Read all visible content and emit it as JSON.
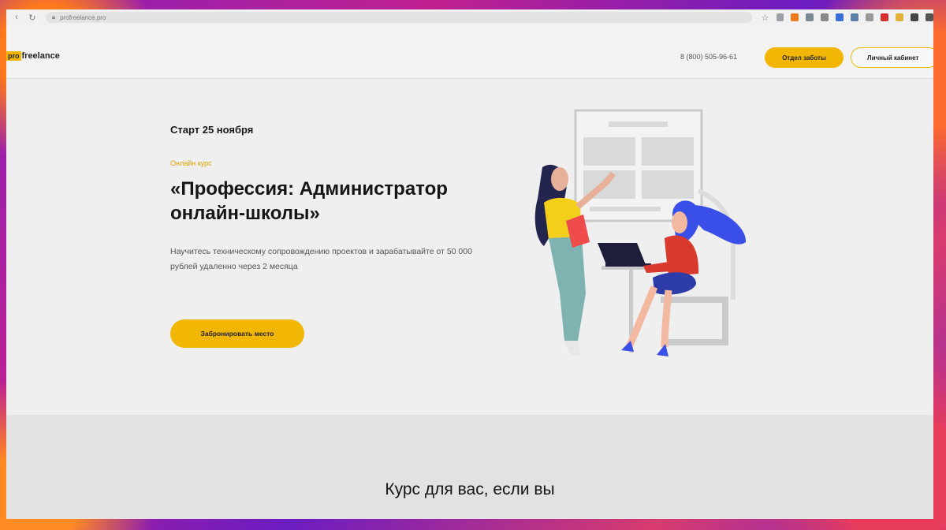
{
  "browser": {
    "url": "profreelance.pro"
  },
  "header": {
    "logo_prefix": "pro",
    "logo_text": "freelance",
    "phone": "8 (800) 505-96-61",
    "care_button": "Отдел заботы",
    "cabinet_button": "Личный кабинет"
  },
  "hero": {
    "start": "Старт 25 ноября",
    "tag": "Онлайн курс",
    "title": "«Профессия: Администратор онлайн-школы»",
    "description": "Научитесь техническому сопровождению проектов и зарабатывайте от 50 000 рублей удаленно через 2 месяца",
    "cta": "Забронировать место"
  },
  "section": {
    "title": "Курс для вас, если вы"
  },
  "colors": {
    "accent": "#f2b705",
    "background": "#efefef"
  }
}
